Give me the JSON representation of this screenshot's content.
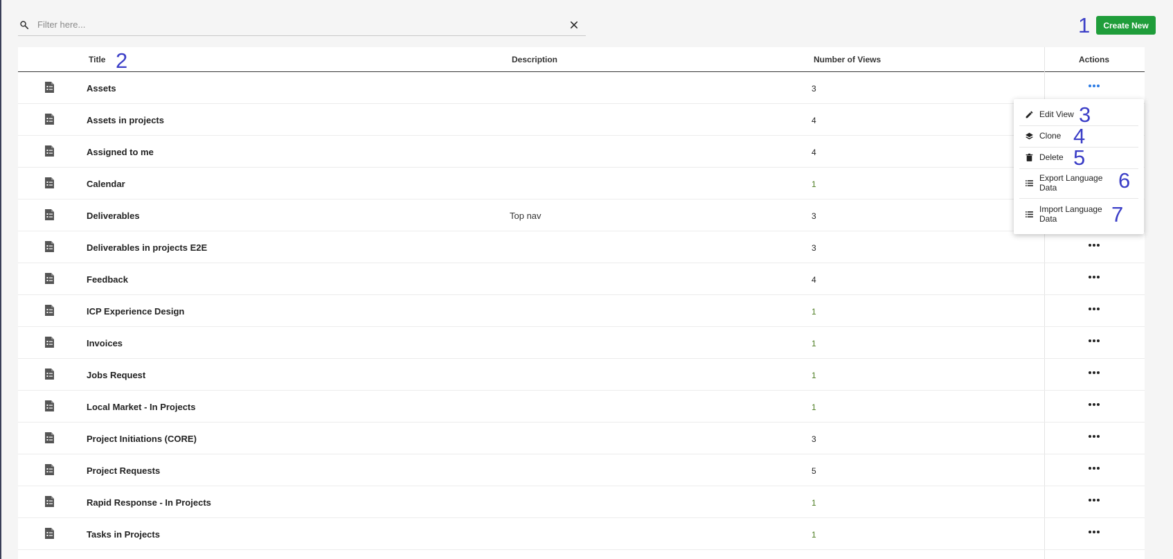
{
  "filter": {
    "placeholder": "Filter here..."
  },
  "toolbar": {
    "create_label": "Create New"
  },
  "annotations": [
    "1",
    "2",
    "3",
    "4",
    "5",
    "6",
    "7"
  ],
  "table": {
    "columns": [
      "Title",
      "Description",
      "Number of Views",
      "Actions"
    ],
    "rows": [
      {
        "title": "Assets",
        "description": "",
        "views": "3"
      },
      {
        "title": "Assets in projects",
        "description": "",
        "views": "4"
      },
      {
        "title": "Assigned to me",
        "description": "",
        "views": "4"
      },
      {
        "title": "Calendar",
        "description": "",
        "views": "1"
      },
      {
        "title": "Deliverables",
        "description": "Top nav",
        "views": "3"
      },
      {
        "title": "Deliverables in projects E2E",
        "description": "",
        "views": "3"
      },
      {
        "title": "Feedback",
        "description": "",
        "views": "4"
      },
      {
        "title": "ICP Experience Design",
        "description": "",
        "views": "1"
      },
      {
        "title": "Invoices",
        "description": "",
        "views": "1"
      },
      {
        "title": "Jobs Request",
        "description": "",
        "views": "1"
      },
      {
        "title": "Local Market - In Projects",
        "description": "",
        "views": "1"
      },
      {
        "title": "Project Initiations (CORE)",
        "description": "",
        "views": "3"
      },
      {
        "title": "Project Requests",
        "description": "",
        "views": "5"
      },
      {
        "title": "Rapid Response - In Projects",
        "description": "",
        "views": "1"
      },
      {
        "title": "Tasks in Projects",
        "description": "",
        "views": "1"
      }
    ]
  },
  "menu": {
    "items": [
      {
        "label": "Edit View",
        "icon": "pencil-icon"
      },
      {
        "label": "Clone",
        "icon": "layers-icon"
      },
      {
        "label": "Delete",
        "icon": "trash-icon"
      },
      {
        "label": "Export Language Data",
        "icon": "list-icon"
      },
      {
        "label": "Import Language Data",
        "icon": "list-icon"
      }
    ]
  },
  "colors": {
    "accent_green": "#1f9d3a",
    "annotation_blue": "#3b3ec7",
    "active_dots": "#2a7be4",
    "views_one": "#4a7a1e"
  }
}
